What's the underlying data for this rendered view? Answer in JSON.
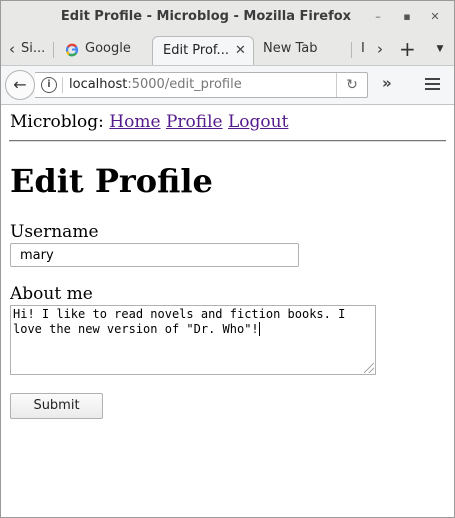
{
  "window": {
    "title": "Edit Profile - Microblog - Mozilla Firefox"
  },
  "tabs": [
    {
      "label": "Si..."
    },
    {
      "label": "Google"
    },
    {
      "label": "Edit Prof..."
    },
    {
      "label": "New Tab"
    },
    {
      "label": "I"
    }
  ],
  "address": {
    "host": "localhost",
    "path": ":5000/edit_profile"
  },
  "page": {
    "nav_prefix": "Microblog:",
    "nav_links": [
      "Home",
      "Profile",
      "Logout"
    ],
    "heading": "Edit Profile",
    "username_label": "Username",
    "username_value": "mary",
    "about_label": "About me",
    "about_value": "Hi! I like to read novels and fiction books. I love the new version of \"Dr. Who\"!",
    "submit_label": "Submit"
  }
}
